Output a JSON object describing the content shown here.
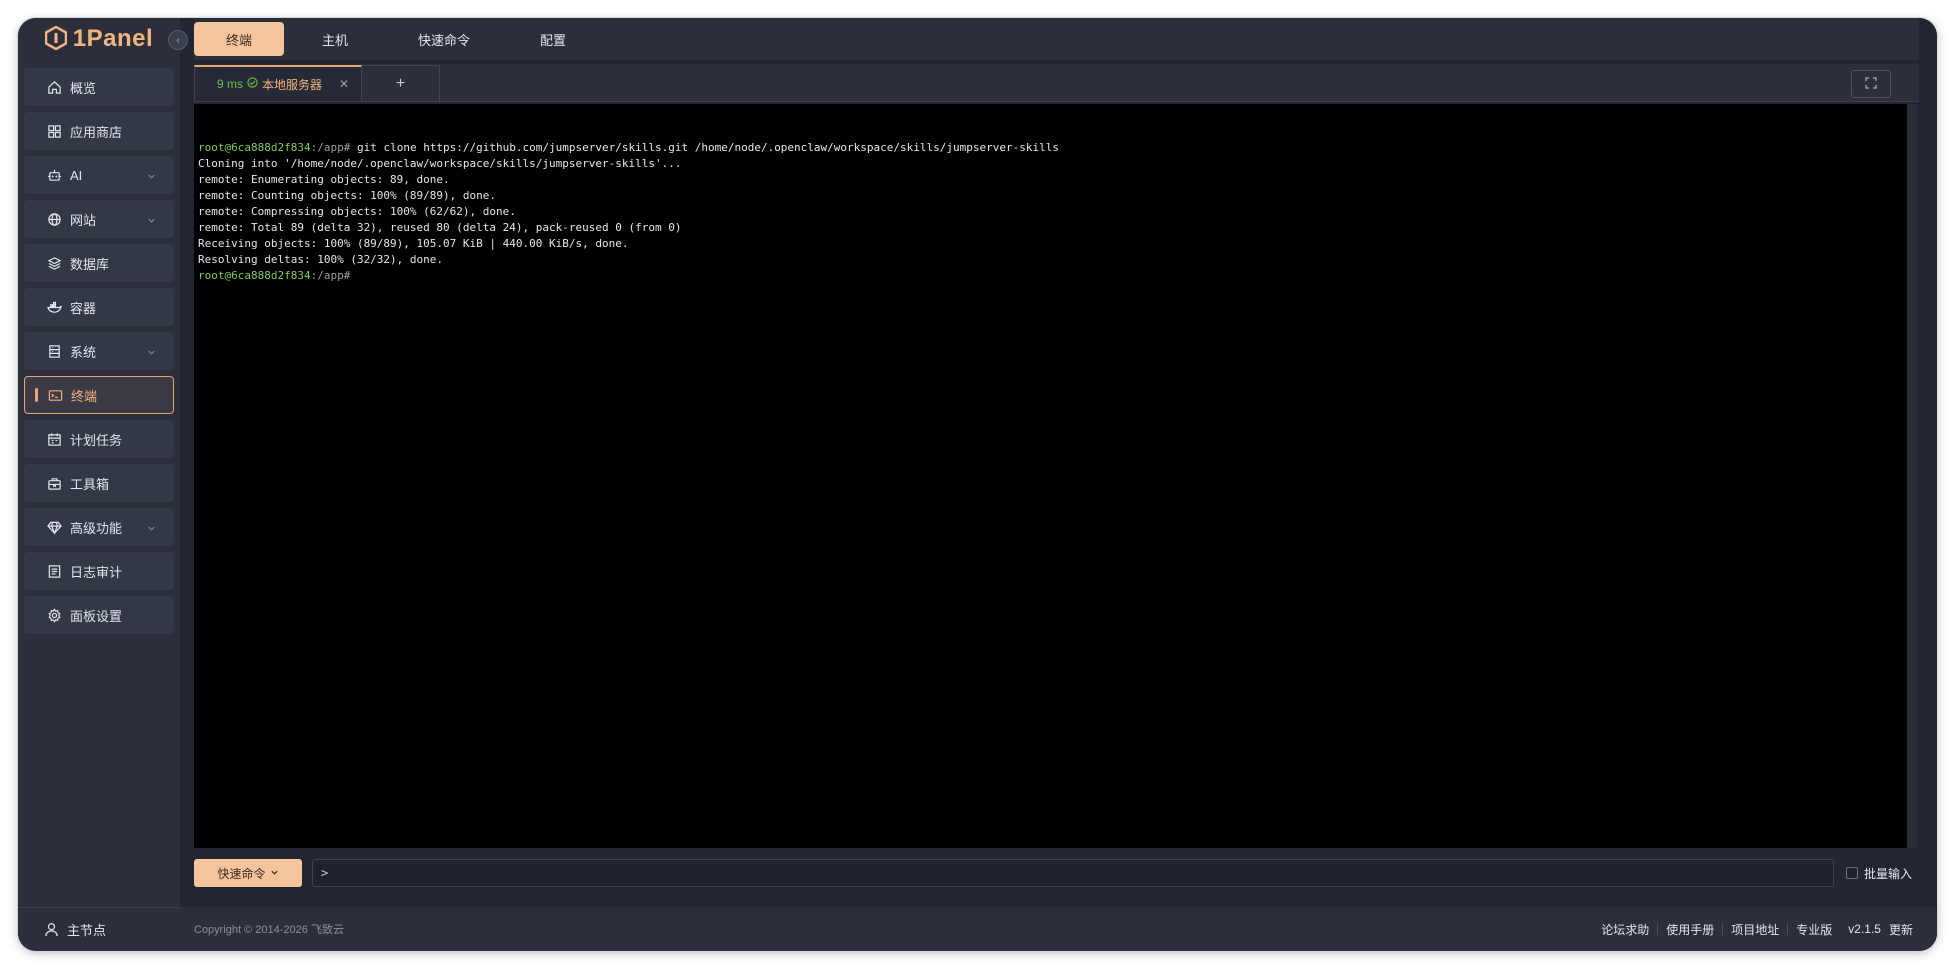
{
  "app": {
    "logo_text": "1Panel"
  },
  "sidebar": {
    "items": [
      {
        "label": "概览",
        "icon": "home-icon",
        "expandable": false,
        "active": false
      },
      {
        "label": "应用商店",
        "icon": "grid-icon",
        "expandable": false,
        "active": false
      },
      {
        "label": "AI",
        "icon": "robot-icon",
        "expandable": true,
        "active": false
      },
      {
        "label": "网站",
        "icon": "globe-icon",
        "expandable": true,
        "active": false
      },
      {
        "label": "数据库",
        "icon": "layers-icon",
        "expandable": false,
        "active": false
      },
      {
        "label": "容器",
        "icon": "docker-icon",
        "expandable": false,
        "active": false
      },
      {
        "label": "系统",
        "icon": "server-icon",
        "expandable": true,
        "active": false
      },
      {
        "label": "终端",
        "icon": "terminal-icon",
        "expandable": false,
        "active": true
      },
      {
        "label": "计划任务",
        "icon": "calendar-icon",
        "expandable": false,
        "active": false
      },
      {
        "label": "工具箱",
        "icon": "toolbox-icon",
        "expandable": false,
        "active": false
      },
      {
        "label": "高级功能",
        "icon": "diamond-icon",
        "expandable": true,
        "active": false
      },
      {
        "label": "日志审计",
        "icon": "log-icon",
        "expandable": false,
        "active": false
      },
      {
        "label": "面板设置",
        "icon": "gear-icon",
        "expandable": false,
        "active": false
      }
    ],
    "footer_label": "主节点"
  },
  "topnav": {
    "tabs": [
      {
        "label": "终端",
        "active": true
      },
      {
        "label": "主机",
        "active": false
      },
      {
        "label": "快速命令",
        "active": false
      },
      {
        "label": "配置",
        "active": false
      }
    ]
  },
  "session": {
    "latency": "9 ms",
    "host": "本地服务器",
    "add_label": "+"
  },
  "terminal": {
    "lines": [
      {
        "user": "root@6ca888d2f834",
        "path": ":/app#",
        "text": " git clone https://github.com/jumpserver/skills.git /home/node/.openclaw/workspace/skills/jumpserver-skills"
      },
      {
        "text": "Cloning into '/home/node/.openclaw/workspace/skills/jumpserver-skills'..."
      },
      {
        "text": "remote: Enumerating objects: 89, done."
      },
      {
        "text": "remote: Counting objects: 100% (89/89), done."
      },
      {
        "text": "remote: Compressing objects: 100% (62/62), done."
      },
      {
        "text": "remote: Total 89 (delta 32), reused 80 (delta 24), pack-reused 0 (from 0)"
      },
      {
        "text": "Receiving objects: 100% (89/89), 105.07 KiB | 440.00 KiB/s, done."
      },
      {
        "text": "Resolving deltas: 100% (32/32), done."
      },
      {
        "user": "root@6ca888d2f834",
        "path": ":/app#",
        "text": ""
      }
    ]
  },
  "cmdbar": {
    "quick_label": "快速命令",
    "input_value": ">",
    "batch_label": "批量输入"
  },
  "footer": {
    "copyright": "Copyright © 2014-2026 飞致云",
    "links": [
      "论坛求助",
      "使用手册",
      "项目地址"
    ],
    "edition": "专业版",
    "version": "v2.1.5",
    "update": "更新"
  },
  "colors": {
    "accent": "#f5c49c",
    "accent_border": "#e8a66f",
    "sidebar_bg": "#2b2f3b",
    "terminal_bg": "#000000",
    "prompt_green": "#7fce55"
  }
}
